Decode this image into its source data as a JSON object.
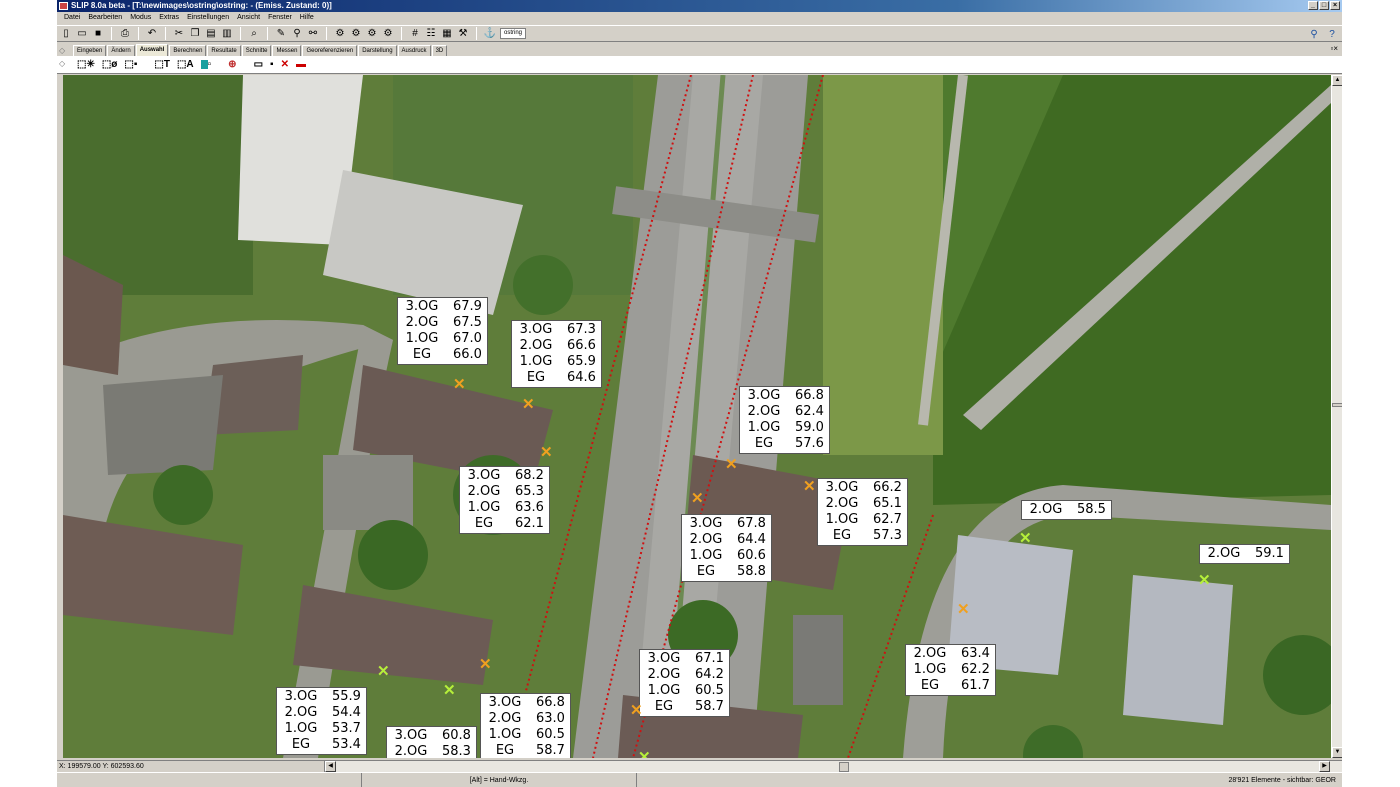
{
  "window": {
    "title": "SLIP 8.0a beta  - [T:\\newimages\\ostring\\ostring:  - (Emiss. Zustand: 0)]"
  },
  "menu": [
    "Datei",
    "Bearbeiten",
    "Modus",
    "Extras",
    "Einstellungen",
    "Ansicht",
    "Fenster",
    "Hilfe"
  ],
  "toolbar": {
    "layer_field": "ostring"
  },
  "tabs": [
    "Eingeben",
    "Ändern",
    "Auswahl",
    "Berechnen",
    "Resultate",
    "Schnitte",
    "Messen",
    "Georeferenzieren",
    "Darstellung",
    "Ausdruck",
    "3D"
  ],
  "active_tab": "Auswahl",
  "colors": {
    "marker_orange": "#f0a020",
    "marker_green": "#b6ef3a",
    "road_line": "#d01010"
  },
  "receivers": [
    {
      "rows": [
        {
          "floor": "3.OG",
          "value": "67.9"
        },
        {
          "floor": "2.OG",
          "value": "67.5"
        },
        {
          "floor": "1.OG",
          "value": "67.0"
        },
        {
          "floor": "EG",
          "value": "66.0"
        }
      ]
    },
    {
      "rows": [
        {
          "floor": "3.OG",
          "value": "67.3"
        },
        {
          "floor": "2.OG",
          "value": "66.6"
        },
        {
          "floor": "1.OG",
          "value": "65.9"
        },
        {
          "floor": "EG",
          "value": "64.6"
        }
      ]
    },
    {
      "rows": [
        {
          "floor": "3.OG",
          "value": "66.8"
        },
        {
          "floor": "2.OG",
          "value": "62.4"
        },
        {
          "floor": "1.OG",
          "value": "59.0"
        },
        {
          "floor": "EG",
          "value": "57.6"
        }
      ]
    },
    {
      "rows": [
        {
          "floor": "3.OG",
          "value": "68.2"
        },
        {
          "floor": "2.OG",
          "value": "65.3"
        },
        {
          "floor": "1.OG",
          "value": "63.6"
        },
        {
          "floor": "EG",
          "value": "62.1"
        }
      ]
    },
    {
      "rows": [
        {
          "floor": "3.OG",
          "value": "66.2"
        },
        {
          "floor": "2.OG",
          "value": "65.1"
        },
        {
          "floor": "1.OG",
          "value": "62.7"
        },
        {
          "floor": "EG",
          "value": "57.3"
        }
      ]
    },
    {
      "rows": [
        {
          "floor": "3.OG",
          "value": "67.8"
        },
        {
          "floor": "2.OG",
          "value": "64.4"
        },
        {
          "floor": "1.OG",
          "value": "60.6"
        },
        {
          "floor": "EG",
          "value": "58.8"
        }
      ]
    },
    {
      "rows": [
        {
          "floor": "2.OG",
          "value": "58.5"
        }
      ]
    },
    {
      "rows": [
        {
          "floor": "2.OG",
          "value": "59.1"
        }
      ]
    },
    {
      "rows": [
        {
          "floor": "2.OG",
          "value": "63.4"
        },
        {
          "floor": "1.OG",
          "value": "62.2"
        },
        {
          "floor": "EG",
          "value": "61.7"
        }
      ]
    },
    {
      "rows": [
        {
          "floor": "3.OG",
          "value": "67.1"
        },
        {
          "floor": "2.OG",
          "value": "64.2"
        },
        {
          "floor": "1.OG",
          "value": "60.5"
        },
        {
          "floor": "EG",
          "value": "58.7"
        }
      ]
    },
    {
      "rows": [
        {
          "floor": "3.OG",
          "value": "55.9"
        },
        {
          "floor": "2.OG",
          "value": "54.4"
        },
        {
          "floor": "1.OG",
          "value": "53.7"
        },
        {
          "floor": "EG",
          "value": "53.4"
        }
      ]
    },
    {
      "rows": [
        {
          "floor": "3.OG",
          "value": "66.8"
        },
        {
          "floor": "2.OG",
          "value": "63.0"
        },
        {
          "floor": "1.OG",
          "value": "60.5"
        },
        {
          "floor": "EG",
          "value": "58.7"
        }
      ]
    },
    {
      "rows": [
        {
          "floor": "3.OG",
          "value": "60.8"
        },
        {
          "floor": "2.OG",
          "value": "58.3"
        }
      ]
    }
  ],
  "status": {
    "coords": "X: 199579.00  Y: 602593.60",
    "hint": "[Alt] = Hand-Wkzg.",
    "elements": "28'921 Elemente  -  sichtbar: GEOR"
  }
}
